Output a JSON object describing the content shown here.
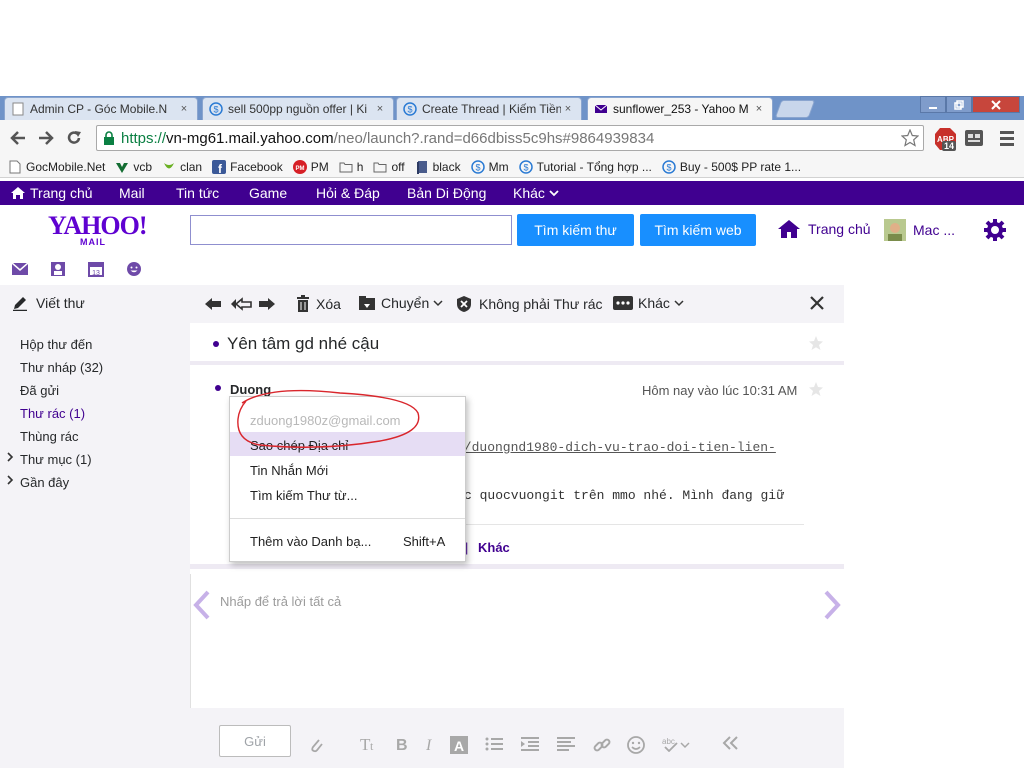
{
  "browser": {
    "tabs": [
      {
        "title": "Admin CP - Góc Mobile.N",
        "close": "×"
      },
      {
        "title": "sell 500pp nguồn offer | Ki",
        "close": "×"
      },
      {
        "title": "Create Thread | Kiếm Tiền",
        "close": "×"
      },
      {
        "title": "sunflower_253 - Yahoo M",
        "close": "×"
      }
    ],
    "url": {
      "scheme": "https://",
      "host": "vn-mg61.mail.yahoo.com",
      "path": "/neo/launch?.rand=d66dbiss5c9hs#9864939834"
    },
    "abp_badge": "14",
    "bookmarks": [
      {
        "label": "GocMobile.Net",
        "icon": "page-icon"
      },
      {
        "label": "vcb",
        "icon": "vcb-icon"
      },
      {
        "label": "clan",
        "icon": "leaf-icon"
      },
      {
        "label": "Facebook",
        "icon": "facebook-icon"
      },
      {
        "label": "PM",
        "icon": "pm-icon"
      },
      {
        "label": "h",
        "icon": "folder-icon"
      },
      {
        "label": "off",
        "icon": "folder-icon"
      },
      {
        "label": "black",
        "icon": "book-icon"
      },
      {
        "label": "Mm",
        "icon": "s-icon"
      },
      {
        "label": "Tutorial - Tổng hợp ...",
        "icon": "s-icon"
      },
      {
        "label": "Buy - 500$ PP rate 1...",
        "icon": "s-icon"
      }
    ]
  },
  "ynav": {
    "items": [
      "Trang chủ",
      "Mail",
      "Tin tức",
      "Game",
      "Hỏi & Đáp",
      "Bản Di Động",
      "Khác"
    ]
  },
  "header": {
    "logo": "YAHOO!",
    "logo_sub": "MAIL",
    "search_mail": "Tìm kiếm thư",
    "search_web": "Tìm kiếm web",
    "home": "Trang chủ",
    "user": "Mac ..."
  },
  "sidebar": {
    "compose": "Viết thư",
    "folders": [
      {
        "label": "Hộp thư đến"
      },
      {
        "label": "Thư nháp (32)"
      },
      {
        "label": "Đã gửi"
      },
      {
        "label": "Thư rác (1)"
      },
      {
        "label": "Thùng rác"
      },
      {
        "label": "Thư mục (1)"
      },
      {
        "label": "Gần đây"
      }
    ]
  },
  "msgtoolbar": {
    "delete": "Xóa",
    "move": "Chuyển",
    "not_spam": "Không phải Thư rác",
    "more": "Khác"
  },
  "message": {
    "subject": "Yên tâm gd nhé cậu",
    "sender": "Duong",
    "date": "Hôm nay vào lúc 10:31 AM",
    "link_fragment": "s/duongnd1980-dich-vu-trao-doi-tien-lien-",
    "body_fragment": "c quocvuongit trên mmo nhé. Mình đang giữ",
    "actions_sep": "|",
    "actions_more": "Khác"
  },
  "context_menu": {
    "email": "zduong1980z@gmail.com",
    "copy": "Sao chép Địa chỉ",
    "new_message": "Tin Nhắn Mới",
    "search_from": "Tìm kiếm Thư từ...",
    "add_contact": "Thêm vào Danh bạ...",
    "add_shortcut": "Shift+A"
  },
  "reply": {
    "placeholder": "Nhấp để trả lời tất cả",
    "send": "Gửi"
  }
}
